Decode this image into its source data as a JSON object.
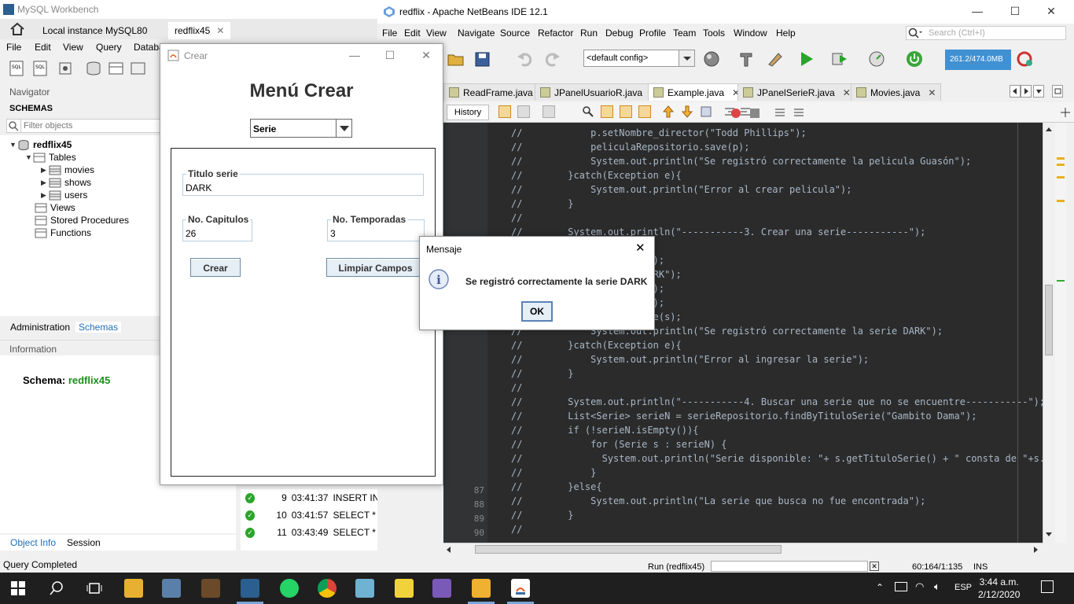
{
  "workbench": {
    "title": "MySQL Workbench",
    "tabs": [
      {
        "label": "Local instance MySQL80"
      },
      {
        "label": "redflix45"
      }
    ],
    "menu": [
      "File",
      "Edit",
      "View",
      "Query",
      "Databa"
    ],
    "navigator_label": "Navigator",
    "schemas_label": "SCHEMAS",
    "filter_placeholder": "Filter objects",
    "tree": {
      "schema": "redflix45",
      "tables_label": "Tables",
      "tables": [
        "movies",
        "shows",
        "users"
      ],
      "views_label": "Views",
      "procedures_label": "Stored Procedures",
      "functions_label": "Functions"
    },
    "admin_tab": "Administration",
    "schemas_tab": "Schemas",
    "information_label": "Information",
    "schema_info": {
      "label": "Schema:",
      "value": "redflix45"
    },
    "object_info_tab": "Object Info",
    "session_tab": "Session",
    "status": "Query Completed",
    "output_rows": [
      {
        "n": "9",
        "time": "03:41:37",
        "query": "INSERT INT"
      },
      {
        "n": "10",
        "time": "03:41:57",
        "query": "SELECT * FI"
      },
      {
        "n": "11",
        "time": "03:43:49",
        "query": "SELECT * FI"
      }
    ]
  },
  "netbeans": {
    "title": "redflix - Apache NetBeans IDE 12.1",
    "menu": [
      "File",
      "Edit",
      "View",
      "Navigate",
      "Source",
      "Refactor",
      "Run",
      "Debug",
      "Profile",
      "Team",
      "Tools",
      "Window",
      "Help"
    ],
    "search_placeholder": "Search (Ctrl+I)",
    "config": "<default config>",
    "memory": "261.2/474.0MB",
    "file_tabs": [
      {
        "label": "ReadFrame.java",
        "active": false
      },
      {
        "label": "JPanelUsuarioR.java",
        "active": false
      },
      {
        "label": "Example.java",
        "active": true
      },
      {
        "label": "JPanelSerieR.java",
        "active": false
      },
      {
        "label": "Movies.java",
        "active": false
      }
    ],
    "history_label": "History",
    "line_numbers": [
      "87",
      "88",
      "89",
      "90"
    ],
    "code_lines": [
      "//            p.setNombre_director(\"Todd Phillips\");",
      "//            peliculaRepositorio.save(p);",
      "//            System.out.println(\"Se registró correctamente la pelicula Guasón\");",
      "//        }catch(Exception e){",
      "//            System.out.println(\"Error al crear pelicula\");",
      "//        }",
      "//",
      "//        System.out.println(\"-----------3. Crear una serie-----------\");",
      "//",
      "//                      ();",
      "//                      ARK\");",
      "//                      3);",
      "//                      6);",
      "//                      ve(s);",
      "//            System.out.println(\"Se registró correctamente la serie DARK\");",
      "//        }catch(Exception e){",
      "//            System.out.println(\"Error al ingresar la serie\");",
      "//        }",
      "//",
      "//        System.out.println(\"-----------4. Buscar una serie que no se encuentre-----------\");",
      "//        List<Serie> serieN = serieRepositorio.findByTituloSerie(\"Gambito Dama\");",
      "//        if (!serieN.isEmpty()){",
      "//            for (Serie s : serieN) {",
      "//              System.out.println(\"Serie disponible: \"+ s.getTituloSerie() + \" consta de \"+s.",
      "//            }",
      "//        }else{",
      "//            System.out.println(\"La serie que busca no fue encontrada\");",
      "//        }",
      "//"
    ],
    "status_run": "Run (redflix45)",
    "status_pos": "60:164/1:135",
    "status_ins": "INS"
  },
  "crear": {
    "title": "Crear",
    "heading": "Menú Crear",
    "combo_value": "Serie",
    "titulo_label": "Titulo serie",
    "titulo_value": "DARK",
    "capitulos_label": "No. Capitulos",
    "capitulos_value": "26",
    "temporadas_label": "No. Temporadas",
    "temporadas_value": "3",
    "crear_btn": "Crear",
    "limpiar_btn": "Limpiar Campos"
  },
  "mensaje": {
    "title": "Mensaje",
    "text": "Se registró correctamente la serie DARK",
    "ok": "OK"
  },
  "taskbar": {
    "language": "ESP",
    "time": "3:44 a.m.",
    "date": "2/12/2020"
  }
}
